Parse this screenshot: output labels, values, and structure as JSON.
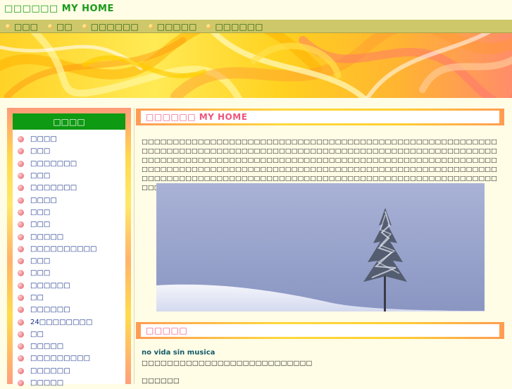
{
  "site": {
    "title": "□□□□□□ MY HOME"
  },
  "nav": {
    "items": [
      {
        "label": "□□□"
      },
      {
        "label": "□□"
      },
      {
        "label": "□□□□□□"
      },
      {
        "label": "□□□□□"
      },
      {
        "label": "□□□□□□"
      }
    ]
  },
  "sidebar": {
    "header": "□□□□",
    "items": [
      {
        "label": "□□□□"
      },
      {
        "label": "□□□"
      },
      {
        "label": "□□□□□□□"
      },
      {
        "label": "□□□"
      },
      {
        "label": "□□□□□□□"
      },
      {
        "label": "□□□□"
      },
      {
        "label": "□□□"
      },
      {
        "label": "□□□"
      },
      {
        "label": "□□□□□"
      },
      {
        "label": "□□□□□□□□□□"
      },
      {
        "label": "□□□"
      },
      {
        "label": "□□□"
      },
      {
        "label": "□□□□□□"
      },
      {
        "label": "□□"
      },
      {
        "label": "□□□□□□"
      },
      {
        "label": "24□□□□□□□□"
      },
      {
        "label": "□□"
      },
      {
        "label": "□□□□□"
      },
      {
        "label": "□□□□□□□□□"
      },
      {
        "label": "□□□□□□"
      },
      {
        "label": "□□□□□"
      }
    ]
  },
  "main": {
    "section_title": "□□□□□□ MY HOME",
    "intro": "□□□□□□□□□□□□□□□□□□□□□□□□□□□□□□□□□□□□□□□□□□□□□□□□□□□□□□□□□□□□□□□□□□□□□□□□□□□□□□□□□□□□□□□□□□□□□□□□□□□□□□□□□□□□□□□□□□□□□□□□□□□□□□□□□□□□□□□□□□□□□□□□□□□□□□□□□□□□□□□□□□□□□□□□□□□□□□□□□□□□□□□□□□□□□□□□□□□□□□□□□□□□□□□□□□□□□□□□□□□□□□□□□□□□□□□□□□□□□□□□□□□□□□□□□□□□□□□□□□□□□□□□□□□□□□□□□□□□□□□□□□□□□□□□□□□□□□□□□□□□□□□□□□□□□",
    "news_section_title": "□□□□□",
    "news": {
      "title": "no vida sin musica",
      "description": "□□□□□□□□□□□□□□□□□□□□□□□□□□□",
      "sub": "□□□□□□"
    }
  },
  "colors": {
    "title_green": "#1a9a1a",
    "nav_bg": "#cfc86a",
    "sidebar_header_bg": "#0e9a12",
    "section_title_pink": "#f0557c",
    "link_blue": "#16308a"
  }
}
